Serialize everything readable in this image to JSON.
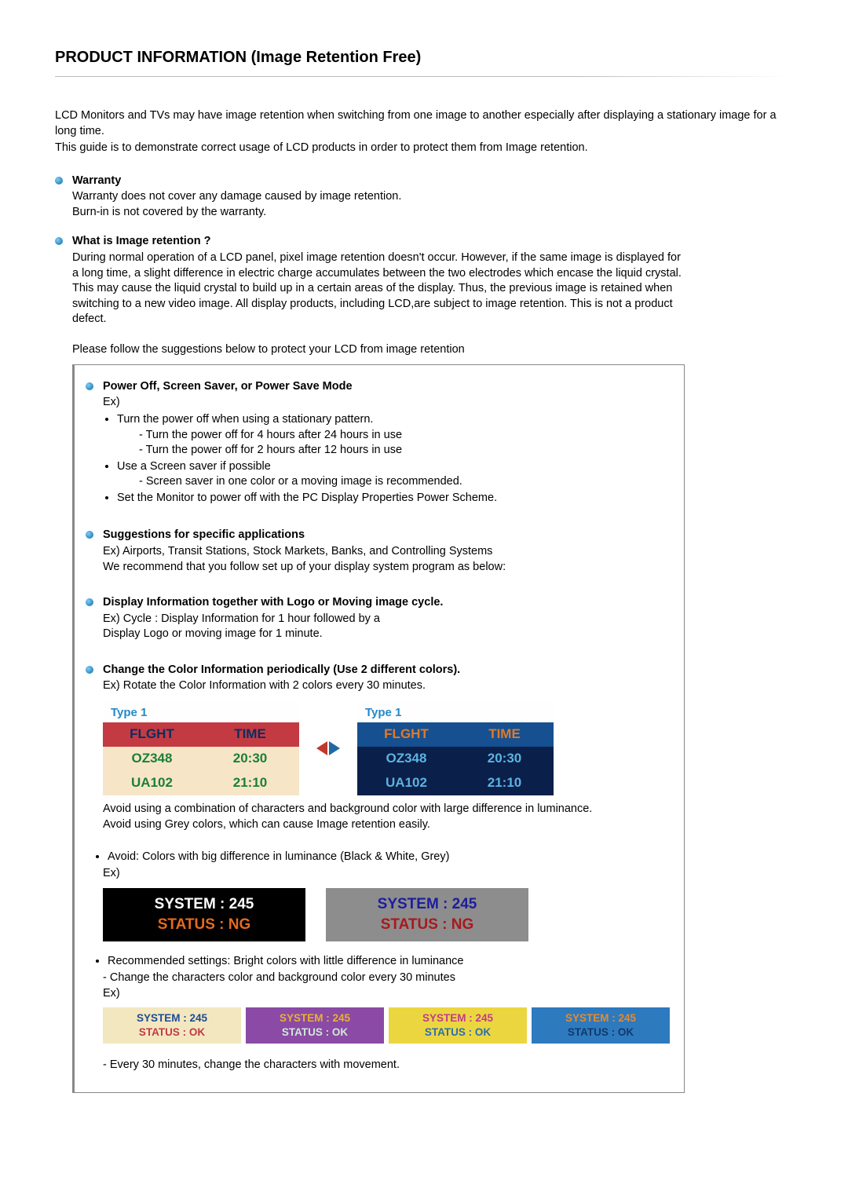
{
  "title": "PRODUCT INFORMATION (Image Retention Free)",
  "intro": {
    "l1": "LCD Monitors and TVs may have image retention when switching from one image to another especially after displaying a stationary image for a long time.",
    "l2": "This guide is to demonstrate correct usage of LCD products in order to protect them from Image retention."
  },
  "warranty": {
    "heading": "Warranty",
    "l1": "Warranty does not cover any damage caused by image retention.",
    "l2": "Burn-in is not covered by the warranty."
  },
  "what_is": {
    "heading": "What is Image retention ?",
    "body": "During normal operation of a LCD panel, pixel image retention doesn't occur. However, if the same image is displayed for a long time, a slight difference in electric charge accumulates between the two electrodes which encase the liquid crystal. This may cause the liquid crystal to build up in a certain areas of the display. Thus, the previous image is retained when switching to a new video image. All display products, including LCD,are subject to image retention. This is not a product defect.",
    "follow": "Please follow the suggestions below to protect your LCD from image retention"
  },
  "box": {
    "power": {
      "heading": "Power Off, Screen Saver, or Power Save Mode",
      "ex": "Ex)",
      "b1": "Turn the power off when using a stationary pattern.",
      "b1a": "- Turn the power off for 4 hours after 24 hours in use",
      "b1b": "- Turn the power off for 2 hours after 12 hours in use",
      "b2": "Use a Screen saver if possible",
      "b2a": "- Screen saver in one color or a moving image is recommended.",
      "b3": "Set the Monitor to power off with the PC Display Properties Power Scheme."
    },
    "suggest": {
      "heading": "Suggestions for specific applications",
      "l1": "Ex) Airports, Transit Stations, Stock Markets, Banks, and Controlling Systems",
      "l2": "We recommend that you follow set up of your display system program as below:"
    },
    "display_info": {
      "heading": "Display Information together with Logo or Moving image cycle.",
      "l1": "Ex) Cycle : Display Information for 1 hour followed by a",
      "l2": "Display Logo or moving image for 1 minute."
    },
    "change_color": {
      "heading": "Change the Color Information periodically (Use 2 different colors).",
      "l1": "Ex) Rotate the Color Information with 2 colors every 30 minutes.",
      "tables": {
        "type_label": "Type 1",
        "col1": "FLGHT",
        "col2": "TIME",
        "r1c1": "OZ348",
        "r1c2": "20:30",
        "r2c1": "UA102",
        "r2c2": "21:10"
      },
      "avoid_p1": "Avoid using a combination of characters and background color with large difference in luminance.",
      "avoid_p2": "Avoid using Grey colors, which can cause Image retention easily.",
      "avoid_bullet": "Avoid: Colors with big difference in luminance (Black & White, Grey)",
      "ex": "Ex)",
      "status": {
        "l1": "SYSTEM : 245",
        "l2": "STATUS : NG"
      },
      "rec_bullet": "Recommended settings: Bright colors with little difference in luminance",
      "rec_sub": "- Change the characters color and background color every 30 minutes",
      "rec_status": {
        "l1": "SYSTEM : 245",
        "l2": "STATUS : OK"
      },
      "every30": "- Every 30 minutes, change the characters with movement."
    }
  }
}
